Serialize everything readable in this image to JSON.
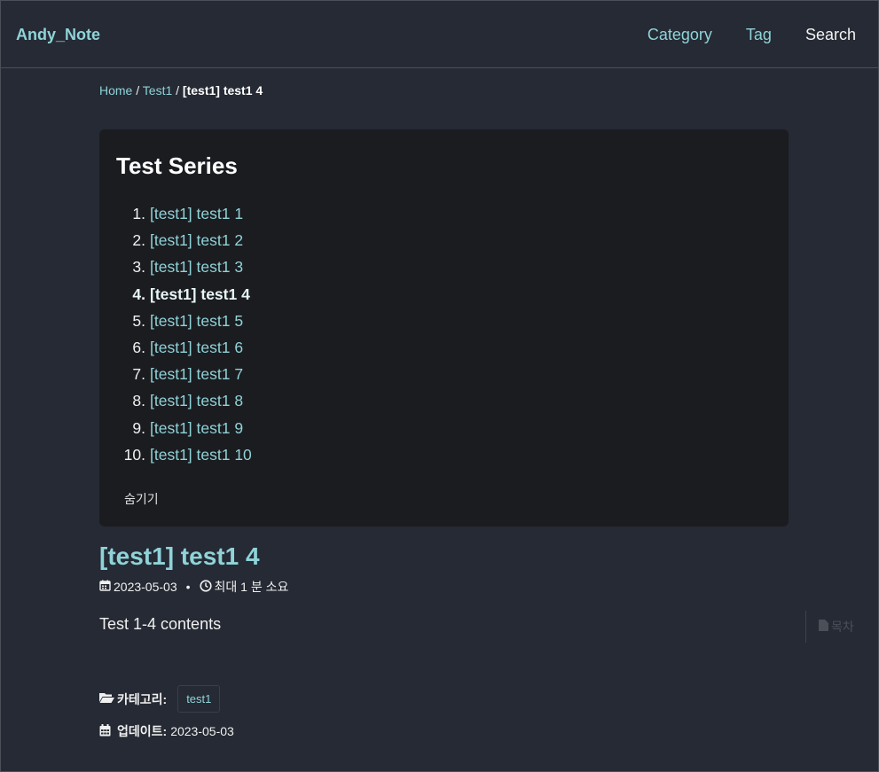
{
  "header": {
    "brand": "Andy_Note",
    "nav": {
      "category": "Category",
      "tag": "Tag",
      "search": "Search"
    }
  },
  "breadcrumb": {
    "home": "Home",
    "sep": "/",
    "section": "Test1",
    "current": "[test1] test1 4"
  },
  "series": {
    "title": "Test Series",
    "items": [
      {
        "num": "1.",
        "label": "[test1] test1 1"
      },
      {
        "num": "2.",
        "label": "[test1] test1 2"
      },
      {
        "num": "3.",
        "label": "[test1] test1 3"
      },
      {
        "num": "4.",
        "label": "[test1] test1 4"
      },
      {
        "num": "5.",
        "label": "[test1] test1 5"
      },
      {
        "num": "6.",
        "label": "[test1] test1 6"
      },
      {
        "num": "7.",
        "label": "[test1] test1 7"
      },
      {
        "num": "8.",
        "label": "[test1] test1 8"
      },
      {
        "num": "9.",
        "label": "[test1] test1 9"
      },
      {
        "num": "10.",
        "label": "[test1] test1 10"
      }
    ],
    "hide_label": "숨기기"
  },
  "post": {
    "title": "[test1] test1 4",
    "date": "2023-05-03",
    "dot": "•",
    "read_time": "최대 1 분 소요",
    "content": "Test 1-4 contents",
    "toc_label": "목차",
    "category_label": "카테고리:",
    "category_chip": "test1",
    "updated_label": "업데이트:",
    "updated_date": "2023-05-03"
  },
  "colors": {
    "background": "#252a34",
    "accent": "#8fd3d8",
    "box": "#1b1c20"
  }
}
